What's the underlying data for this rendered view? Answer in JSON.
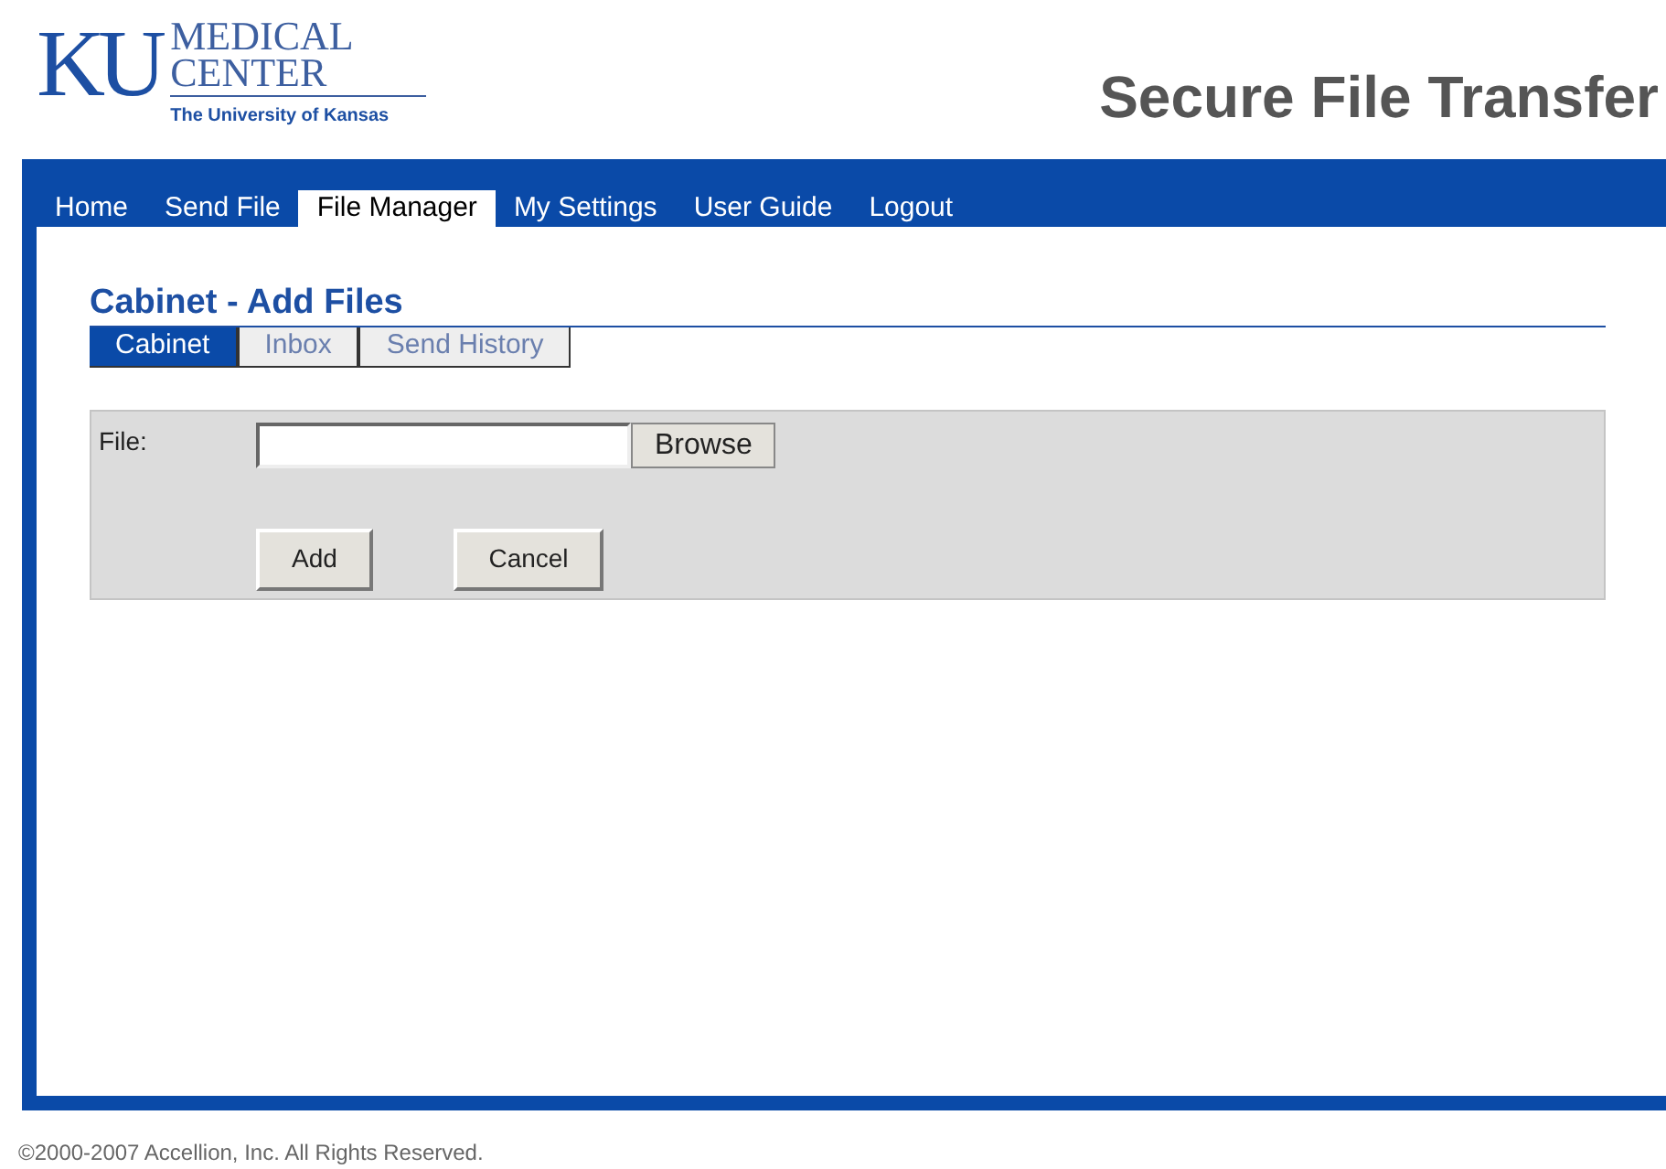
{
  "logo": {
    "mark": "KU",
    "line1": "MEDICAL",
    "line2": "CENTER",
    "subtitle": "The University of Kansas"
  },
  "header_title": "Secure File Transfer",
  "nav": [
    {
      "label": "Home",
      "selected": false
    },
    {
      "label": "Send File",
      "selected": false
    },
    {
      "label": "File Manager",
      "selected": true
    },
    {
      "label": "My Settings",
      "selected": false
    },
    {
      "label": "User Guide",
      "selected": false
    },
    {
      "label": "Logout",
      "selected": false
    }
  ],
  "page_title": "Cabinet - Add Files",
  "subtabs": [
    {
      "label": "Cabinet",
      "selected": true
    },
    {
      "label": "Inbox",
      "selected": false
    },
    {
      "label": "Send History",
      "selected": false
    }
  ],
  "form": {
    "file_label": "File:",
    "browse": "Browse",
    "add": "Add",
    "cancel": "Cancel"
  },
  "footer": "©2000-2007 Accellion, Inc. All Rights Reserved."
}
